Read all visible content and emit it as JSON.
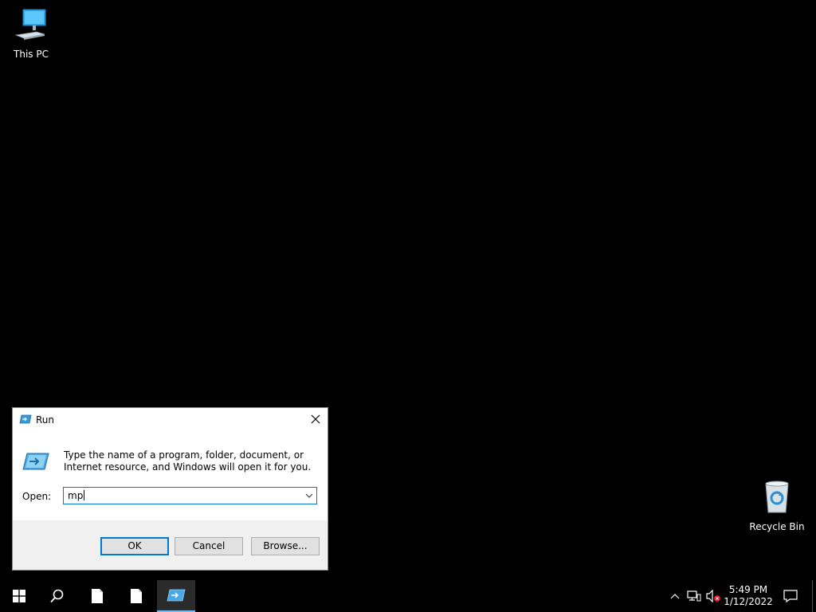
{
  "desktop": {
    "icons": [
      {
        "label": "This PC"
      },
      {
        "label": "Recycle Bin"
      }
    ]
  },
  "run_dialog": {
    "title": "Run",
    "description": "Type the name of a program, folder, document, or Internet resource, and Windows will open it for you.",
    "open_label": "Open:",
    "open_value": "mp",
    "ok_label": "OK",
    "cancel_label": "Cancel",
    "browse_label": "Browse..."
  },
  "taskbar": {
    "items": [
      "start-icon",
      "search-icon",
      "document-icon",
      "document-icon",
      "run-icon"
    ],
    "active_item": "run-icon",
    "clock": {
      "time": "5:49 PM",
      "date": "1/12/2022"
    },
    "tray_icons": [
      "chevron-up-icon",
      "network-icon",
      "volume-muted-icon",
      "notification-icon"
    ]
  },
  "colors": {
    "desktop": "#000000",
    "accent": "#0078d7",
    "dialog_footer": "#f0f0f0"
  }
}
